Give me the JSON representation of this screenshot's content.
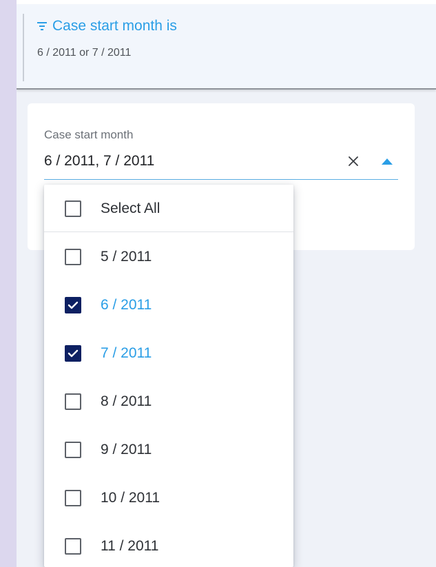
{
  "filter_summary": {
    "title": "Case start month is",
    "value": "6 / 2011 or 7 / 2011",
    "icon": "filter-icon"
  },
  "field": {
    "label": "Case start month",
    "value": "6 / 2011, 7 / 2011",
    "clear_icon": "close-icon",
    "toggle_icon": "caret-up-icon"
  },
  "dropdown": {
    "select_all": {
      "label": "Select All",
      "checked": false
    },
    "options": [
      {
        "label": "5 / 2011",
        "checked": false
      },
      {
        "label": "6 / 2011",
        "checked": true
      },
      {
        "label": "7 / 2011",
        "checked": true
      },
      {
        "label": "8 / 2011",
        "checked": false
      },
      {
        "label": "9 / 2011",
        "checked": false
      },
      {
        "label": "10 / 2011",
        "checked": false
      },
      {
        "label": "11 / 2011",
        "checked": false
      }
    ]
  },
  "colors": {
    "accent_blue": "#2a9ee6",
    "checkbox_checked": "#0d2062",
    "panel_bg": "#eff2f8",
    "outer_bg": "#dcd7ee"
  }
}
